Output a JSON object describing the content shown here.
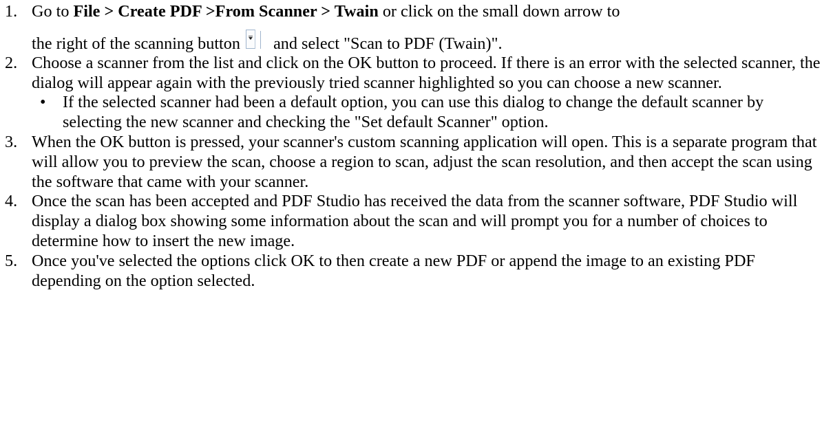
{
  "steps": [
    {
      "number": "1.",
      "line1": {
        "lead": "Go to ",
        "menu_path": "File > Create PDF >From Scanner > Twain",
        "tail": " or click on the small down arrow to"
      },
      "line2": {
        "lead": "the right of the scanning button ",
        "tail": " and select \"Scan to PDF (Twain)\"."
      }
    },
    {
      "number": "2.",
      "text": "Choose a scanner from the list and click on the OK button to proceed.  If there is an error with the selected scanner, the dialog will appear again with the previously tried scanner highlighted so you can choose a new scanner.",
      "bullets": [
        {
          "bullet": "•",
          "text": "If the selected scanner had been a default option, you can use this dialog to change the default scanner by selecting the new scanner and checking the \"Set default Scanner\" option."
        }
      ]
    },
    {
      "number": "3.",
      "text": "When the OK button is pressed, your scanner's custom scanning application will open. This is a separate program that will allow you to preview the scan, choose a region to scan, adjust the scan resolution, and then accept the scan using the software that came with your scanner."
    },
    {
      "number": "4.",
      "text": "Once the scan has been accepted and PDF Studio has received the data from the scanner software, PDF Studio will display a dialog box showing some information about the scan and will prompt you for a number of choices to determine how to insert the new image."
    },
    {
      "number": "5.",
      "text": "Once you've selected the options click OK to then create a new PDF or append the image to an existing PDF depending on the option selected."
    }
  ],
  "icons": {
    "scan_dropdown": "scan-dropdown-arrow-icon"
  }
}
